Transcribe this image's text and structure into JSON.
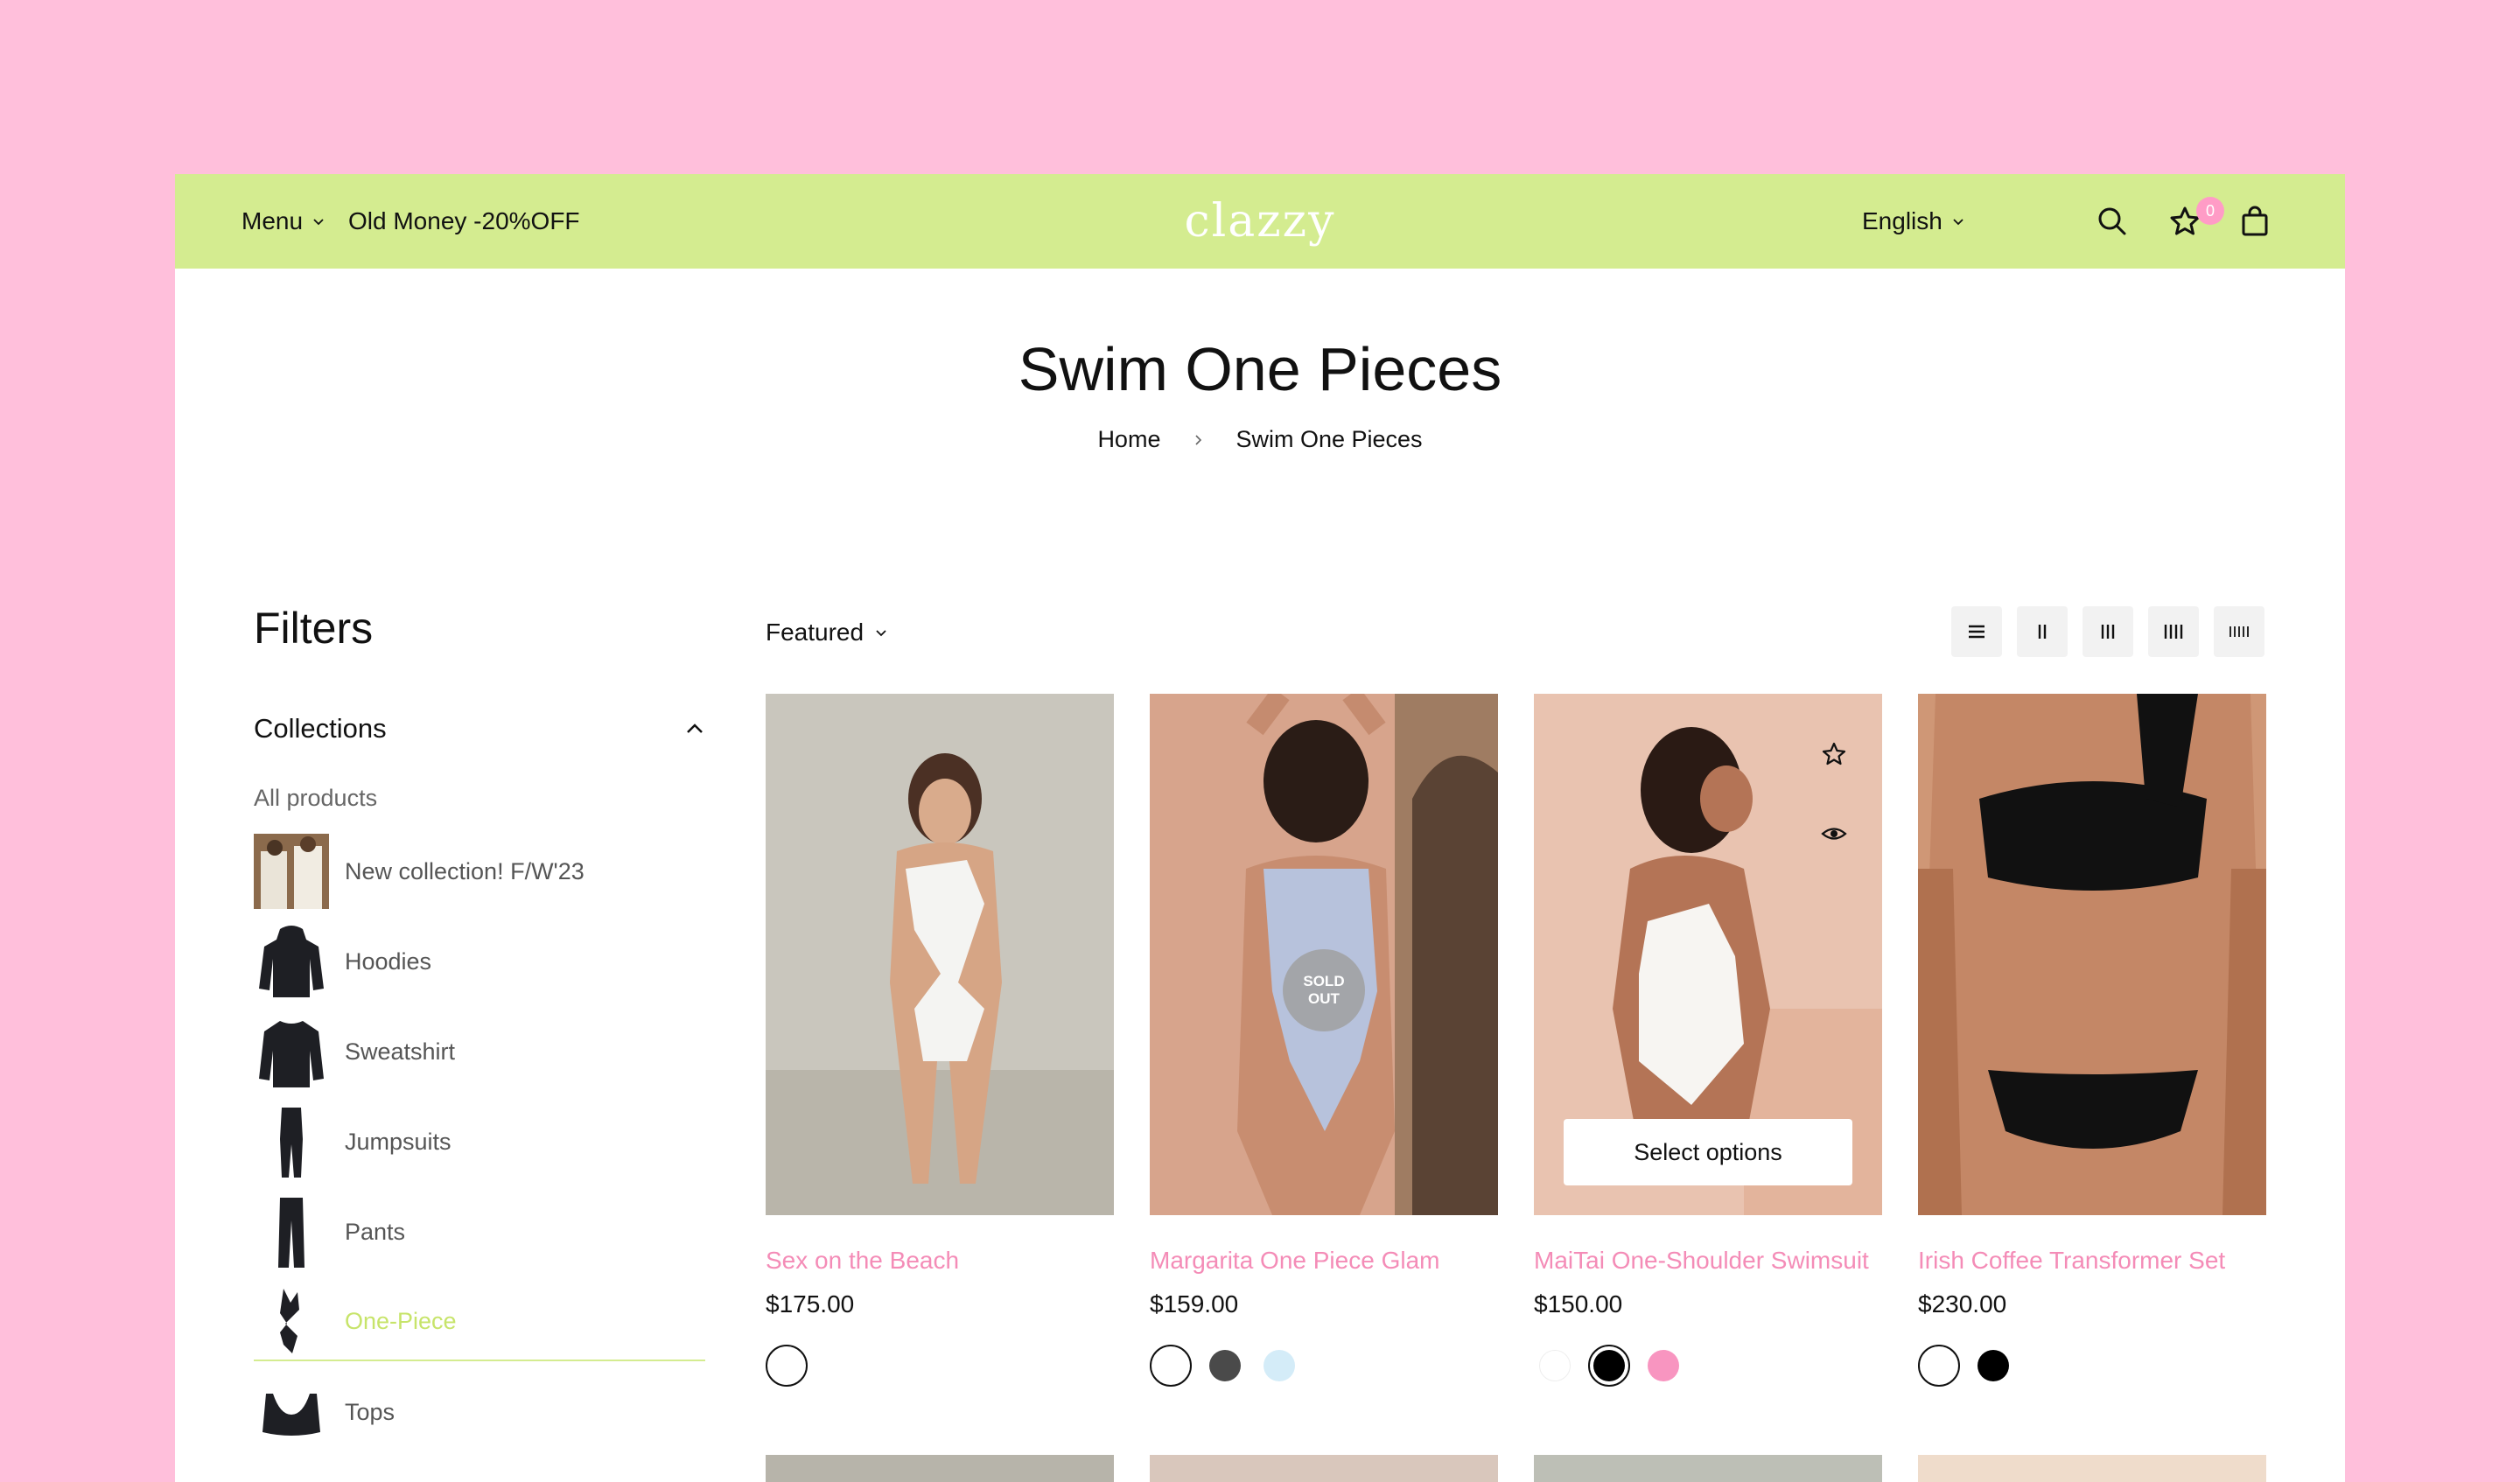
{
  "header": {
    "menu_label": "Menu",
    "promo_label": "Old Money -20%OFF",
    "logo_text": "clazzy",
    "language": "English",
    "wishlist_count": "0"
  },
  "page": {
    "title": "Swim One Pieces",
    "breadcrumb": [
      "Home",
      "Swim One Pieces"
    ]
  },
  "filters": {
    "title": "Filters",
    "collections_label": "Collections",
    "all_products": "All products",
    "items": [
      {
        "label": "New collection! F/W'23"
      },
      {
        "label": "Hoodies"
      },
      {
        "label": "Sweatshirt"
      },
      {
        "label": "Jumpsuits"
      },
      {
        "label": "Pants"
      },
      {
        "label": "One-Piece",
        "active": true
      },
      {
        "label": "Tops"
      }
    ]
  },
  "toolbar": {
    "sort_label": "Featured",
    "view_options": [
      "list",
      "2-columns",
      "3-columns",
      "4-columns",
      "5-columns"
    ]
  },
  "products": [
    {
      "name": "Sex on the Beach",
      "price": "$175.00",
      "swatches": [
        "#ffffff"
      ]
    },
    {
      "name": "Margarita One Piece Glam",
      "price": "$159.00",
      "badge": "SOLD OUT",
      "swatches": [
        "#ffffff",
        "#4a4a4a",
        "#d4ecf8"
      ]
    },
    {
      "name": "MaiTai One-Shoulder Swimsuit",
      "price": "$150.00",
      "button": "Select options",
      "swatches": [
        "#ffffff",
        "#000000",
        "#f895c0"
      ]
    },
    {
      "name": "Irish Coffee Transformer Set",
      "price": "$230.00",
      "swatches": [
        "#ffffff",
        "#000000"
      ]
    }
  ],
  "colors": {
    "page_bg": "#ffbfdb",
    "header_bg": "#d4ec90",
    "accent_pink": "#f48cb7",
    "active_green": "#c7e46a"
  }
}
